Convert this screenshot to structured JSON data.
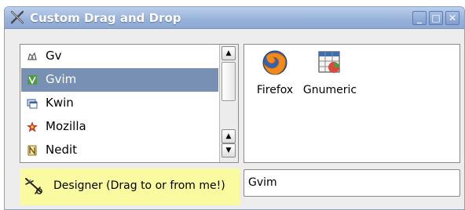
{
  "window": {
    "title": "Custom Drag and Drop",
    "buttons": {
      "minimize": "_",
      "maximize": "□",
      "close": "✕"
    }
  },
  "list": {
    "selected_index": 1,
    "items": [
      {
        "label": "Gv",
        "icon": "gv-icon"
      },
      {
        "label": "Gvim",
        "icon": "gvim-icon"
      },
      {
        "label": "Kwin",
        "icon": "kwin-icon"
      },
      {
        "label": "Mozilla",
        "icon": "mozilla-icon"
      },
      {
        "label": "Nedit",
        "icon": "nedit-icon"
      }
    ],
    "scroll_arrows": {
      "up": "▲",
      "down": "▼"
    }
  },
  "icon_view": {
    "items": [
      {
        "label": "Firefox",
        "icon": "firefox-icon"
      },
      {
        "label": "Gnumeric",
        "icon": "gnumeric-icon"
      }
    ]
  },
  "designer": {
    "label": "Designer (Drag to or from me!)",
    "icon": "designer-icon",
    "background_color": "#fafaa0"
  },
  "text_field": {
    "value": "Gvim"
  },
  "colors": {
    "titlebar": "#99b3da",
    "selection": "#7790b4"
  }
}
